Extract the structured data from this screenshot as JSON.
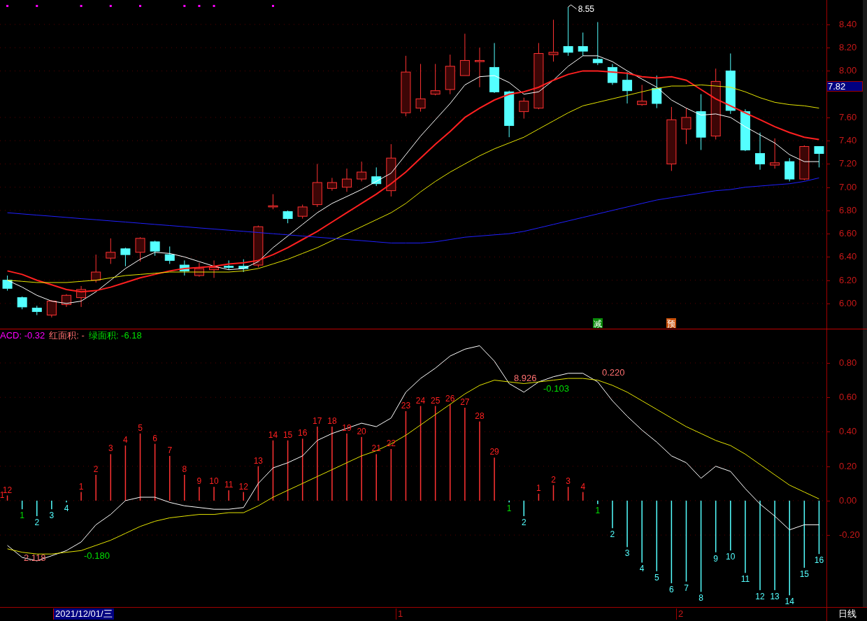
{
  "price_panel": {
    "current_price": "7.82",
    "signals": [
      {
        "text": "减",
        "color": "#0a8a0a"
      },
      {
        "text": "预",
        "color": "#c8500a"
      }
    ],
    "chart_data": {
      "type": "candlestick",
      "categories": [
        null,
        null,
        null,
        null,
        null,
        null,
        null,
        null,
        null,
        null,
        null,
        null,
        null,
        null,
        null,
        null,
        null,
        null,
        null,
        null,
        null,
        null,
        null,
        null,
        null,
        null,
        null,
        null,
        null,
        null,
        null,
        null,
        null,
        null,
        null,
        null,
        null,
        null,
        null,
        null,
        null,
        null,
        null,
        null,
        null,
        null,
        null,
        null,
        null,
        null,
        null,
        null,
        null,
        null,
        null,
        null
      ],
      "grid": true,
      "ylim": [
        5.783,
        8.61
      ],
      "yticks": [
        {
          "value": 6,
          "label": "6.00"
        },
        {
          "value": 6.2,
          "label": "6.20"
        },
        {
          "value": 6.4,
          "label": "6.40"
        },
        {
          "value": 6.6,
          "label": "6.60"
        },
        {
          "value": 6.8,
          "label": "6.80"
        },
        {
          "value": 7,
          "label": "7.00"
        },
        {
          "value": 7.2,
          "label": "7.20"
        },
        {
          "value": 7.4,
          "label": "7.40"
        },
        {
          "value": 7.6,
          "label": "7.60"
        },
        {
          "value": 8,
          "label": "8.00"
        },
        {
          "value": 8.2,
          "label": "8.20"
        },
        {
          "value": 8.4,
          "label": "8.40"
        }
      ],
      "ohlc": [
        [
          6.2,
          6.24,
          6.11,
          6.13
        ],
        [
          6.05,
          6.06,
          5.95,
          5.97
        ],
        [
          5.96,
          5.98,
          5.9,
          5.93
        ],
        [
          5.9,
          6.03,
          5.88,
          6.02
        ],
        [
          5.99,
          6.08,
          5.97,
          6.07
        ],
        [
          6.05,
          6.15,
          5.97,
          6.12
        ],
        [
          6.2,
          6.42,
          6.18,
          6.27
        ],
        [
          6.39,
          6.56,
          6.34,
          6.44
        ],
        [
          6.47,
          6.48,
          6.32,
          6.42
        ],
        [
          6.44,
          6.57,
          6.36,
          6.56
        ],
        [
          6.53,
          6.54,
          6.41,
          6.45
        ],
        [
          6.42,
          6.49,
          6.34,
          6.37
        ],
        [
          6.33,
          6.37,
          6.24,
          6.28
        ],
        [
          6.24,
          6.35,
          6.23,
          6.3
        ],
        [
          6.29,
          6.37,
          6.22,
          6.31
        ],
        [
          6.32,
          6.37,
          6.29,
          6.31
        ],
        [
          6.32,
          6.38,
          6.27,
          6.3
        ],
        [
          6.33,
          6.67,
          6.31,
          6.66
        ],
        [
          6.83,
          6.94,
          6.81,
          6.84
        ],
        [
          6.79,
          6.8,
          6.69,
          6.73
        ],
        [
          6.75,
          6.85,
          6.73,
          6.83
        ],
        [
          6.85,
          7.2,
          6.83,
          7.04
        ],
        [
          6.99,
          7.08,
          6.97,
          7.04
        ],
        [
          7.0,
          7.16,
          6.96,
          7.07
        ],
        [
          7.07,
          7.22,
          7.05,
          7.13
        ],
        [
          7.09,
          7.17,
          7.01,
          7.03
        ],
        [
          6.97,
          7.37,
          6.92,
          7.25
        ],
        [
          7.64,
          8.13,
          7.61,
          7.99
        ],
        [
          7.68,
          8.06,
          7.65,
          7.76
        ],
        [
          7.8,
          8.06,
          7.79,
          7.83
        ],
        [
          7.84,
          8.14,
          7.8,
          8.04
        ],
        [
          7.96,
          8.32,
          7.96,
          8.09
        ],
        [
          8.08,
          8.2,
          7.86,
          8.09
        ],
        [
          8.03,
          8.24,
          7.81,
          7.82
        ],
        [
          7.82,
          7.83,
          7.43,
          7.53
        ],
        [
          7.65,
          7.77,
          7.59,
          7.74
        ],
        [
          7.68,
          8.24,
          7.67,
          8.15
        ],
        [
          8.14,
          8.44,
          8.08,
          8.16
        ],
        [
          8.21,
          8.55,
          8.13,
          8.16
        ],
        [
          8.21,
          8.33,
          8.13,
          8.17
        ],
        [
          8.1,
          8.42,
          8.05,
          8.07
        ],
        [
          8.03,
          8.06,
          7.88,
          7.9
        ],
        [
          7.92,
          7.99,
          7.72,
          7.83
        ],
        [
          7.71,
          7.88,
          7.7,
          7.74
        ],
        [
          7.85,
          7.96,
          7.68,
          7.72
        ],
        [
          7.2,
          7.69,
          7.14,
          7.58
        ],
        [
          7.5,
          7.68,
          7.37,
          7.6
        ],
        [
          7.65,
          7.8,
          7.32,
          7.43
        ],
        [
          7.44,
          8.02,
          7.41,
          7.91
        ],
        [
          8.0,
          8.15,
          7.63,
          7.66
        ],
        [
          7.65,
          7.67,
          7.31,
          7.32
        ],
        [
          7.29,
          7.47,
          7.15,
          7.2
        ],
        [
          7.19,
          7.42,
          7.16,
          7.21
        ],
        [
          7.22,
          7.25,
          7.05,
          7.07
        ],
        [
          7.07,
          7.36,
          7.06,
          7.35
        ],
        [
          7.35,
          7.35,
          7.17,
          7.29
        ]
      ],
      "series": [
        {
          "type": "line",
          "color": "#ffffff",
          "values": [
            6.2,
            6.14,
            6.07,
            6.02,
            6.0,
            6.02,
            6.1,
            6.2,
            6.3,
            6.38,
            6.44,
            6.43,
            6.4,
            6.36,
            6.32,
            6.29,
            6.3,
            6.36,
            6.48,
            6.58,
            6.68,
            6.78,
            6.86,
            6.92,
            6.98,
            7.05,
            7.12,
            7.28,
            7.44,
            7.58,
            7.72,
            7.88,
            7.95,
            7.96,
            7.9,
            7.8,
            7.82,
            7.92,
            8.04,
            8.13,
            8.13,
            8.08,
            8.0,
            7.93,
            7.86,
            7.75,
            7.68,
            7.62,
            7.63,
            7.6,
            7.52,
            7.45,
            7.38,
            7.28,
            7.22,
            7.22
          ]
        },
        {
          "type": "line",
          "color": "#ff2020",
          "values": [
            6.28,
            6.25,
            6.2,
            6.16,
            6.12,
            6.1,
            6.11,
            6.14,
            6.18,
            6.22,
            6.25,
            6.28,
            6.3,
            6.31,
            6.32,
            6.34,
            6.35,
            6.37,
            6.42,
            6.48,
            6.55,
            6.62,
            6.7,
            6.78,
            6.86,
            6.94,
            7.03,
            7.13,
            7.25,
            7.37,
            7.48,
            7.6,
            7.68,
            7.75,
            7.8,
            7.82,
            7.86,
            7.92,
            7.97,
            8.0,
            8.0,
            7.99,
            7.98,
            7.95,
            7.94,
            7.95,
            7.92,
            7.84,
            7.76,
            7.7,
            7.64,
            7.58,
            7.52,
            7.47,
            7.43,
            7.41
          ]
        },
        {
          "type": "line",
          "color": "#e6e600",
          "values": [
            6.2,
            6.19,
            6.18,
            6.18,
            6.18,
            6.19,
            6.2,
            6.22,
            6.24,
            6.25,
            6.26,
            6.27,
            6.27,
            6.27,
            6.27,
            6.27,
            6.28,
            6.3,
            6.34,
            6.38,
            6.43,
            6.48,
            6.54,
            6.6,
            6.66,
            6.72,
            6.78,
            6.86,
            6.96,
            7.05,
            7.13,
            7.2,
            7.27,
            7.33,
            7.38,
            7.43,
            7.5,
            7.57,
            7.64,
            7.7,
            7.73,
            7.76,
            7.79,
            7.82,
            7.85,
            7.87,
            7.87,
            7.88,
            7.87,
            7.86,
            7.82,
            7.77,
            7.73,
            7.71,
            7.7,
            7.68
          ]
        },
        {
          "type": "line",
          "color": "#2020ff",
          "values": [
            6.78,
            6.77,
            6.76,
            6.75,
            6.74,
            6.73,
            6.72,
            6.71,
            6.7,
            6.69,
            6.68,
            6.67,
            6.66,
            6.65,
            6.64,
            6.63,
            6.62,
            6.61,
            6.6,
            6.59,
            6.58,
            6.57,
            6.56,
            6.55,
            6.54,
            6.53,
            6.52,
            6.52,
            6.52,
            6.53,
            6.55,
            6.57,
            6.58,
            6.59,
            6.6,
            6.62,
            6.65,
            6.68,
            6.71,
            6.74,
            6.77,
            6.8,
            6.83,
            6.86,
            6.89,
            6.91,
            6.93,
            6.95,
            6.97,
            6.98,
            7.0,
            7.01,
            7.02,
            7.03,
            7.05,
            7.08
          ]
        }
      ],
      "annotations": [
        {
          "text": "8.55"
        }
      ]
    }
  },
  "macd_panel": {
    "legend": [
      {
        "text": "ACD: -0.32",
        "color": "#ff00ff"
      },
      {
        "text": "红面积: -",
        "color": "#ff7070"
      },
      {
        "text": "绿面积: -6.18",
        "color": "#00e000"
      }
    ],
    "cut_count": "1",
    "bar_counts": [
      "12",
      "1",
      "2",
      "3",
      "4",
      "1",
      "2",
      "3",
      "4",
      "5",
      "6",
      "7",
      "8",
      "9",
      "10",
      "11",
      "12",
      "13",
      "14",
      "15",
      "16",
      "17",
      "18",
      "19",
      "20",
      "21",
      "22",
      "23",
      "24",
      "25",
      "26",
      "27",
      "28",
      "29",
      "1",
      "2",
      "1",
      "2",
      "3",
      "4",
      "1",
      "2",
      "3",
      "4",
      "5",
      "6",
      "7",
      "8",
      "9",
      "10",
      "11",
      "12",
      "13",
      "14",
      "15",
      "16"
    ],
    "value_labels": [
      {
        "text": "2.118",
        "color": "#ff7070"
      },
      {
        "text": "-0.180",
        "color": "#00e000"
      },
      {
        "text": "8.926",
        "color": "#ff7070"
      },
      {
        "text": "-0.103",
        "color": "#00e000"
      },
      {
        "text": "0.220",
        "color": "#ff7070"
      }
    ],
    "chart_data": {
      "type": "bar",
      "grid": true,
      "ylim": [
        -0.618,
        0.995
      ],
      "colors": [
        "#ff3232",
        "#54ffff",
        "#54ffff",
        "#54ffff",
        "#54ffff",
        "#ff3232",
        "#ff3232",
        "#ff3232",
        "#ff3232",
        "#ff3232",
        "#ff3232",
        "#ff3232",
        "#ff3232",
        "#ff3232",
        "#ff3232",
        "#ff3232",
        "#ff3232",
        "#ff3232",
        "#ff3232",
        "#ff3232",
        "#ff3232",
        "#ff3232",
        "#ff3232",
        "#ff3232",
        "#ff3232",
        "#ff3232",
        "#ff3232",
        "#ff3232",
        "#ff3232",
        "#ff3232",
        "#ff3232",
        "#ff3232",
        "#ff3232",
        "#ff3232",
        "#54ffff",
        "#54ffff",
        "#ff3232",
        "#ff3232",
        "#ff3232",
        "#ff3232",
        "#54ffff",
        "#54ffff",
        "#54ffff",
        "#54ffff",
        "#54ffff",
        "#54ffff",
        "#54ffff",
        "#54ffff",
        "#54ffff",
        "#54ffff",
        "#54ffff",
        "#54ffff",
        "#54ffff",
        "#54ffff",
        "#54ffff",
        "#54ffff"
      ],
      "categories": [
        null,
        null,
        null,
        null,
        null,
        null,
        null,
        null,
        null,
        null,
        null,
        null,
        null,
        null,
        null,
        null,
        null,
        null,
        null,
        null,
        null,
        null,
        null,
        null,
        null,
        null,
        null,
        null,
        null,
        null,
        null,
        null,
        null,
        null,
        null,
        null,
        null,
        null,
        null,
        null,
        null,
        null,
        null,
        null,
        null,
        null,
        null,
        null,
        null,
        null,
        null,
        null,
        null,
        null,
        null,
        null
      ],
      "yticks": [
        {
          "value": -0.2,
          "label": "-0.20"
        },
        {
          "value": 0,
          "label": "0.00"
        },
        {
          "value": 0.2,
          "label": "0.20"
        },
        {
          "value": 0.4,
          "label": "0.40"
        },
        {
          "value": 0.6,
          "label": "0.60"
        },
        {
          "value": 0.8,
          "label": "0.80"
        }
      ],
      "values": [
        0.03,
        -0.05,
        -0.09,
        -0.05,
        -0.01,
        0.05,
        0.15,
        0.27,
        0.32,
        0.39,
        0.33,
        0.26,
        0.15,
        0.08,
        0.08,
        0.06,
        0.05,
        0.2,
        0.35,
        0.35,
        0.36,
        0.43,
        0.43,
        0.39,
        0.37,
        0.27,
        0.3,
        0.52,
        0.55,
        0.55,
        0.56,
        0.54,
        0.46,
        0.25,
        -0.01,
        -0.09,
        0.04,
        0.09,
        0.08,
        0.05,
        -0.02,
        -0.16,
        -0.27,
        -0.36,
        -0.41,
        -0.48,
        -0.47,
        -0.53,
        -0.3,
        -0.29,
        -0.42,
        -0.52,
        -0.52,
        -0.55,
        -0.39,
        -0.31
      ],
      "series": [
        {
          "type": "line",
          "color": "#ffffff",
          "values": [
            -0.26,
            -0.33,
            -0.35,
            -0.32,
            -0.29,
            -0.24,
            -0.14,
            -0.08,
            0.0,
            0.02,
            0.02,
            -0.01,
            -0.03,
            -0.04,
            -0.05,
            -0.05,
            -0.04,
            0.1,
            0.19,
            0.22,
            0.26,
            0.35,
            0.39,
            0.42,
            0.45,
            0.43,
            0.48,
            0.63,
            0.71,
            0.77,
            0.84,
            0.88,
            0.9,
            0.81,
            0.68,
            0.63,
            0.69,
            0.72,
            0.74,
            0.74,
            0.69,
            0.58,
            0.49,
            0.41,
            0.34,
            0.26,
            0.22,
            0.13,
            0.2,
            0.17,
            0.07,
            -0.02,
            -0.09,
            -0.17,
            -0.14,
            -0.14
          ]
        },
        {
          "type": "line",
          "color": "#e6e600",
          "values": [
            -0.28,
            -0.3,
            -0.31,
            -0.31,
            -0.3,
            -0.29,
            -0.26,
            -0.23,
            -0.19,
            -0.15,
            -0.12,
            -0.1,
            -0.09,
            -0.08,
            -0.08,
            -0.07,
            -0.07,
            -0.03,
            0.02,
            0.06,
            0.1,
            0.14,
            0.18,
            0.22,
            0.26,
            0.29,
            0.33,
            0.38,
            0.44,
            0.5,
            0.56,
            0.62,
            0.67,
            0.7,
            0.69,
            0.68,
            0.69,
            0.7,
            0.71,
            0.71,
            0.7,
            0.67,
            0.63,
            0.58,
            0.53,
            0.48,
            0.43,
            0.39,
            0.35,
            0.32,
            0.27,
            0.21,
            0.15,
            0.09,
            0.05,
            0.01
          ]
        }
      ]
    }
  },
  "time_axis": {
    "date": "2021/12/01/三",
    "month_marks": [
      "1",
      "2"
    ],
    "period": "日线"
  }
}
